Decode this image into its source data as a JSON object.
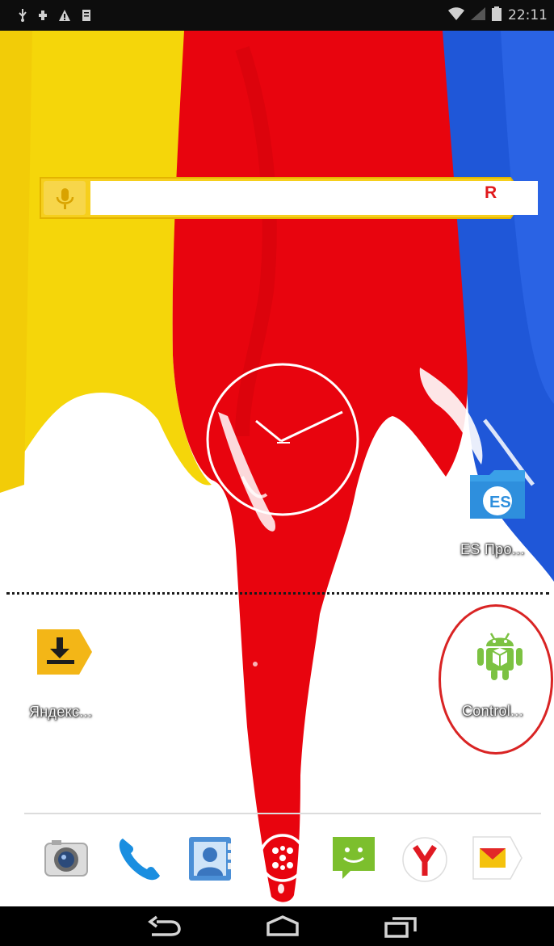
{
  "status_bar": {
    "time": "22:11",
    "left_icons": [
      "usb-icon",
      "sync-icon",
      "warning-icon",
      "storage-icon"
    ],
    "right_icons": [
      "wifi-icon",
      "signal-icon",
      "battery-icon"
    ]
  },
  "wallpaper": {
    "colors": {
      "yellow": "#f5d60a",
      "red": "#e8040e",
      "blue": "#1f57d8",
      "white": "#ffffff"
    }
  },
  "search_widget": {
    "value": "",
    "logo": "Я",
    "icon": "microphone-icon"
  },
  "clock_widget": {
    "type": "analog",
    "hour_hand": "10",
    "minute_hand": "2"
  },
  "home_apps": [
    {
      "id": "es",
      "label": "ES Про...",
      "icon": "es-file-explorer-icon"
    },
    {
      "id": "yandex",
      "label": "Яндекс...",
      "icon": "yandex-download-icon"
    },
    {
      "id": "control",
      "label": "Control...",
      "icon": "android-robot-icon",
      "highlighted": true
    }
  ],
  "dock": [
    {
      "label": "Camera",
      "icon": "camera-icon"
    },
    {
      "label": "Phone",
      "icon": "phone-icon"
    },
    {
      "label": "Contacts",
      "icon": "contacts-icon"
    },
    {
      "label": "Apps",
      "icon": "app-drawer-icon"
    },
    {
      "label": "Messaging",
      "icon": "messages-icon"
    },
    {
      "label": "Yandex Browser",
      "icon": "yandex-browser-icon"
    },
    {
      "label": "Yandex Mail",
      "icon": "mail-icon"
    }
  ],
  "nav_bar": {
    "buttons": [
      "back-icon",
      "home-icon",
      "recent-apps-icon"
    ]
  }
}
